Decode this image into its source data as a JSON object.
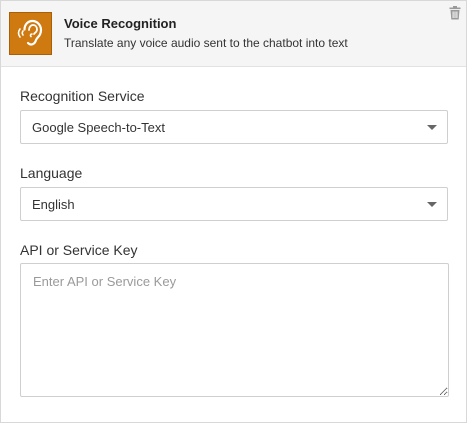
{
  "plugin": {
    "title": "Voice Recognition",
    "description": "Translate any voice audio sent to the chatbot into text",
    "icon": "ear-sound-icon",
    "icon_color": "#cf7a10",
    "delete_icon": "trash-icon"
  },
  "fields": {
    "recognition_service": {
      "label": "Recognition Service",
      "value": "Google Speech-to-Text"
    },
    "language": {
      "label": "Language",
      "value": "English"
    },
    "api_key": {
      "label": "API or Service Key",
      "placeholder": "Enter API or Service Key",
      "value": ""
    }
  }
}
